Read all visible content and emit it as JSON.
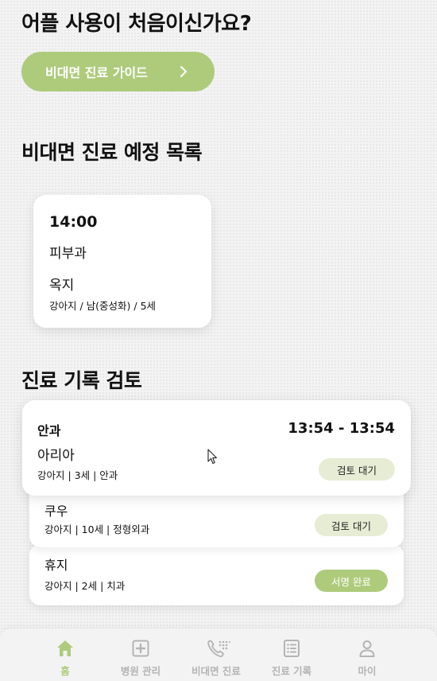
{
  "intro": {
    "heading": "어플 사용이 처음이신가요?",
    "guide_button": "비대면 진료 가이드"
  },
  "schedule": {
    "title": "비대면 진료 예정 목록",
    "appointment": {
      "time": "14:00",
      "department": "피부과",
      "pet_name": "옥지",
      "pet_info": "강아지 / 남(중성화) / 5세"
    }
  },
  "review": {
    "title": "진료 기록 검토",
    "records": [
      {
        "department": "안과",
        "time_range": "13:54 - 13:54",
        "pet_name": "아리아",
        "pet_info": "강아지 | 3세 | 안과",
        "status": "검토 대기"
      },
      {
        "pet_name": "쿠우",
        "pet_info": "강아지 | 10세 | 정형외과",
        "status": "검토 대기"
      },
      {
        "pet_name": "휴지",
        "pet_info": "강아지 | 2세 | 치과",
        "status": "서명 완료"
      }
    ]
  },
  "nav": {
    "items": [
      {
        "label": "홈",
        "icon": "home-icon",
        "active": true
      },
      {
        "label": "병원 관리",
        "icon": "hospital-plus-icon"
      },
      {
        "label": "비대면 진료",
        "icon": "phone-keypad-icon"
      },
      {
        "label": "진료 기록",
        "icon": "record-list-icon"
      },
      {
        "label": "마이",
        "icon": "person-icon"
      }
    ]
  },
  "colors": {
    "accent": "#aecb7c",
    "pending_badge": "#e7edd5",
    "inactive_nav": "#b4b4b4"
  }
}
